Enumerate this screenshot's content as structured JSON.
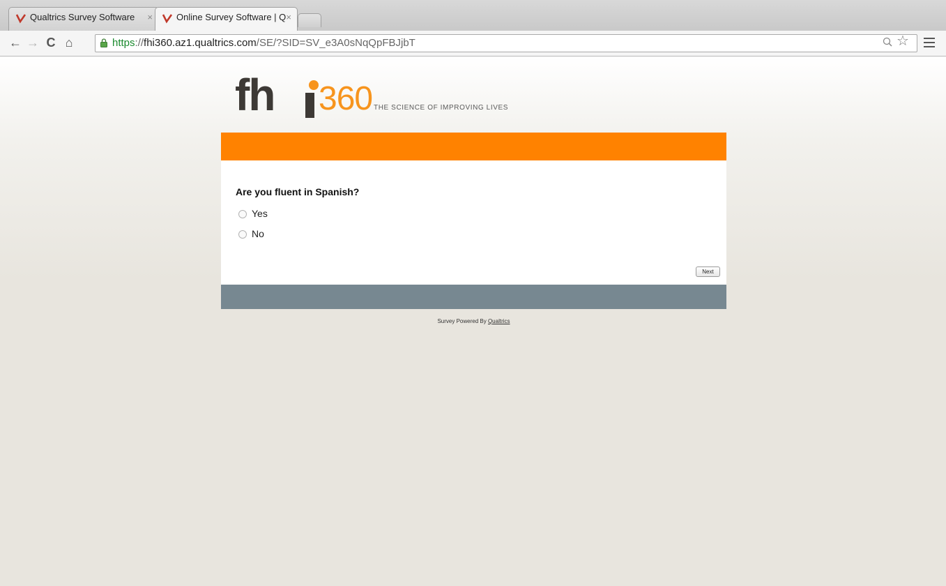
{
  "browser": {
    "tabs": [
      {
        "title": "Qualtrics Survey Software",
        "active": false
      },
      {
        "title": "Online Survey Software | Q",
        "active": true
      }
    ],
    "url": {
      "scheme": "https",
      "separator": "://",
      "host": "fhi360.az1.qualtrics.com",
      "path": "/SE/?SID=SV_e3A0sNqQpFBJjbT"
    },
    "icons": [
      "back-icon",
      "forward-icon",
      "reload-icon",
      "home-icon",
      "lock-icon",
      "zoom-icon",
      "bookmark-star-icon",
      "menu-icon"
    ]
  },
  "logo": {
    "wordmark_main": "fh",
    "wordmark_number": "360",
    "tagline": "THE SCIENCE OF IMPROVING LIVES"
  },
  "colors": {
    "orange_band": "#ff8200",
    "gray_band": "#778891",
    "logo_orange": "#f7941d",
    "logo_dark": "#3d3935"
  },
  "survey": {
    "question": "Are you fluent in Spanish?",
    "choices": [
      "Yes",
      "No"
    ],
    "next_label": "Next"
  },
  "footer": {
    "prefix": "Survey Powered By ",
    "link": "Qualtrics"
  }
}
